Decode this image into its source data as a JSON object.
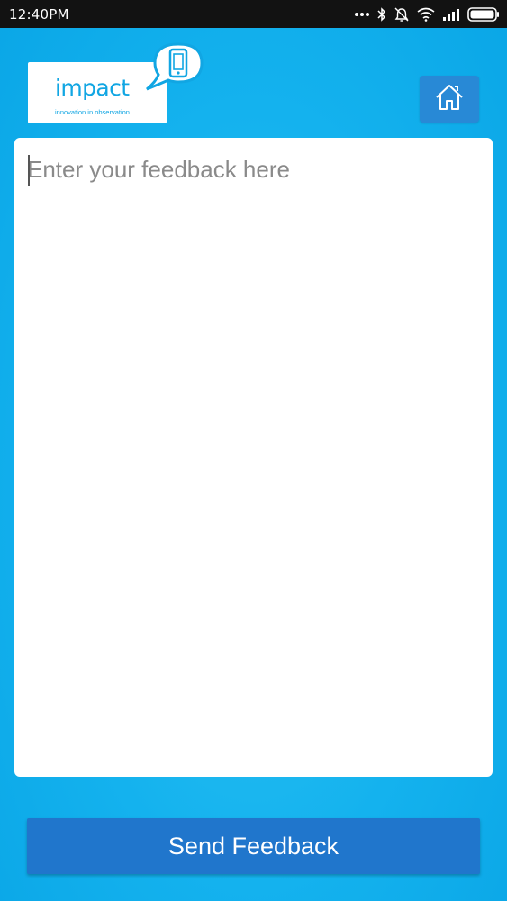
{
  "status_bar": {
    "time": "12:40PM",
    "icons": [
      "more-dots-icon",
      "bluetooth-icon",
      "alarm-off-icon",
      "wifi-icon",
      "signal-icon",
      "battery-icon"
    ]
  },
  "header": {
    "logo": {
      "wordmark": "impact",
      "tagline": "innovation in observation"
    },
    "home_button": {
      "icon": "home-icon"
    }
  },
  "feedback": {
    "value": "",
    "placeholder": "Enter your feedback here"
  },
  "actions": {
    "send_label": "Send Feedback"
  },
  "colors": {
    "background": "#14b2ee",
    "button": "#2076cc",
    "home_button": "#2889d6",
    "logo_blue": "#11a6e3"
  }
}
